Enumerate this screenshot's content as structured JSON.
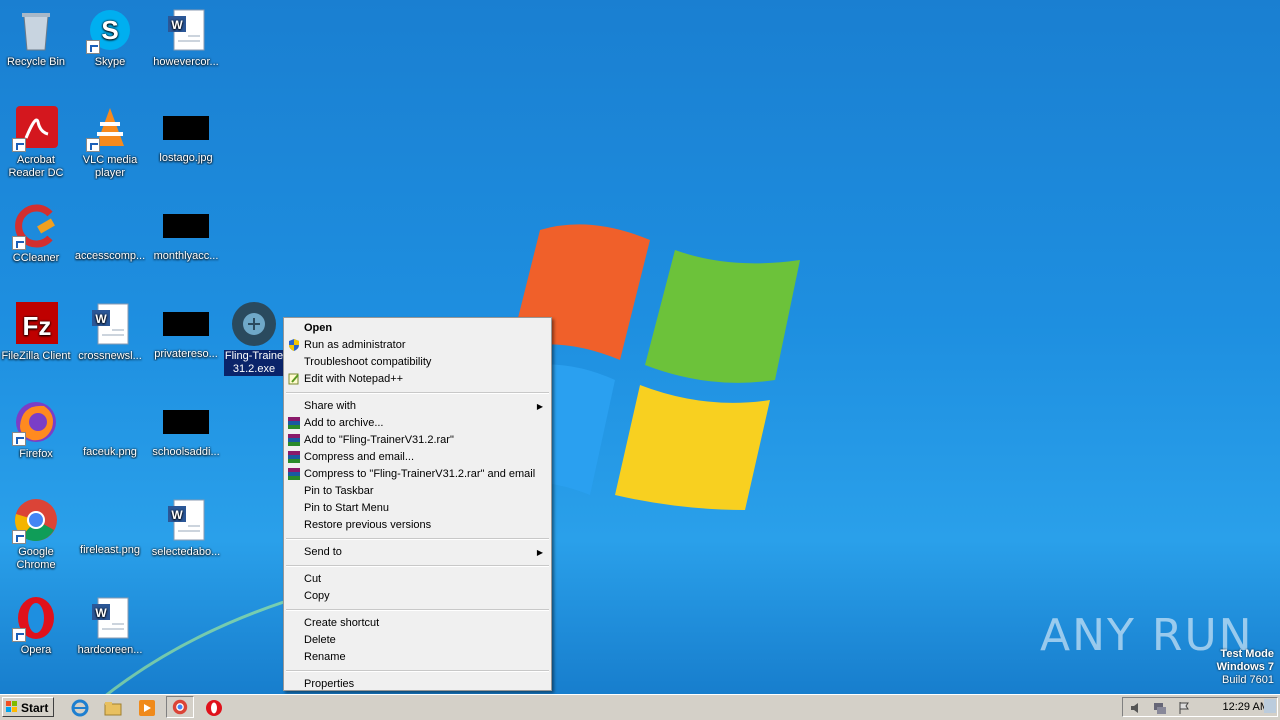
{
  "desktop_icons": [
    {
      "label": "Recycle Bin",
      "icon": "recycle-bin-icon"
    },
    {
      "label": "Skype",
      "icon": "skype-icon"
    },
    {
      "label": "howevercor...",
      "icon": "word-doc-icon"
    },
    {
      "label": "Acrobat Reader DC",
      "icon": "acrobat-icon"
    },
    {
      "label": "VLC media player",
      "icon": "vlc-icon"
    },
    {
      "label": "lostago.jpg",
      "icon": "image-file-icon"
    },
    {
      "label": "CCleaner",
      "icon": "ccleaner-icon"
    },
    {
      "label": "accesscomp...",
      "icon": "image-file-icon"
    },
    {
      "label": "monthlyacc...",
      "icon": "image-file-icon"
    },
    {
      "label": "FileZilla Client",
      "icon": "filezilla-icon"
    },
    {
      "label": "crossnewsl...",
      "icon": "word-doc-icon"
    },
    {
      "label": "privatereso...",
      "icon": "image-file-icon"
    },
    {
      "label": "Fling-TrainerV31.2.exe",
      "label_line1": "Fling-Traine",
      "label_line2": "31.2.exe",
      "icon": "trainer-exe-icon"
    },
    {
      "label": "Firefox",
      "icon": "firefox-icon"
    },
    {
      "label": "faceuk.png",
      "icon": "image-file-icon"
    },
    {
      "label": "schoolsaddi...",
      "icon": "image-file-icon"
    },
    {
      "label": "Google Chrome",
      "icon": "chrome-icon"
    },
    {
      "label": "fireleast.png",
      "icon": "image-file-icon"
    },
    {
      "label": "selectedabo...",
      "icon": "word-doc-icon"
    },
    {
      "label": "Opera",
      "icon": "opera-icon"
    },
    {
      "label": "hardcoreen...",
      "icon": "word-doc-icon"
    }
  ],
  "context_menu": {
    "items": [
      {
        "label": "Open",
        "bold": true
      },
      {
        "label": "Run as administrator",
        "icon": "shield-icon"
      },
      {
        "label": "Troubleshoot compatibility"
      },
      {
        "label": "Edit with Notepad++",
        "icon": "notepad-plus-icon"
      },
      {
        "label": "Share with",
        "submenu": true
      },
      {
        "label": "Add to archive...",
        "icon": "winrar-icon"
      },
      {
        "label": "Add to \"Fling-TrainerV31.2.rar\"",
        "icon": "winrar-icon"
      },
      {
        "label": "Compress and email...",
        "icon": "winrar-icon"
      },
      {
        "label": "Compress to \"Fling-TrainerV31.2.rar\" and email",
        "icon": "winrar-icon"
      },
      {
        "label": "Pin to Taskbar"
      },
      {
        "label": "Pin to Start Menu"
      },
      {
        "label": "Restore previous versions"
      },
      {
        "label": "Send to",
        "submenu": true
      },
      {
        "label": "Cut"
      },
      {
        "label": "Copy"
      },
      {
        "label": "Create shortcut"
      },
      {
        "label": "Delete"
      },
      {
        "label": "Rename"
      },
      {
        "label": "Properties"
      }
    ]
  },
  "taskbar": {
    "start_label": "Start",
    "pinned": [
      "internet-explorer-icon",
      "explorer-folder-icon",
      "media-player-icon",
      "chrome-icon",
      "opera-icon"
    ],
    "clock": "12:29 AM"
  },
  "watermark": {
    "line1": "Test Mode",
    "line2": "Windows 7",
    "line3": "Build 7601",
    "brand": "ANY RUN"
  },
  "colors": {
    "desktop_blue": "#1e8fe0",
    "selection": "#0a246a",
    "menu_bg": "#f0f0f0"
  }
}
